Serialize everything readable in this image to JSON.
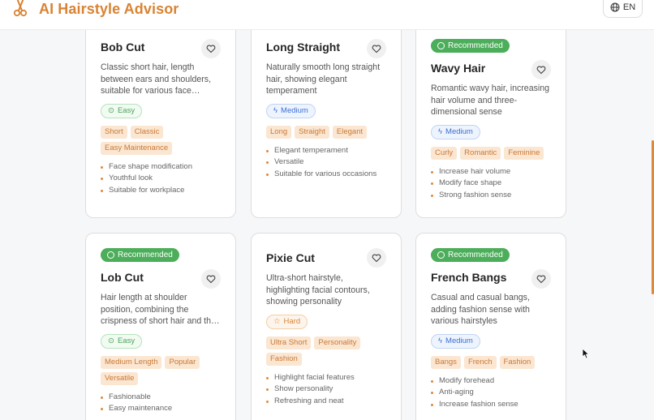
{
  "header": {
    "app_title": "AI Hairstyle Advisor",
    "lang_label": "EN"
  },
  "cards": [
    {
      "recommended": false,
      "title": "Bob Cut",
      "description": "Classic short hair, length between ears and shoulders, suitable for various face…",
      "difficulty": "Easy",
      "tags": [
        "Short",
        "Classic",
        "Easy Maintenance"
      ],
      "features": [
        "Face shape modification",
        "Youthful look",
        "Suitable for workplace"
      ]
    },
    {
      "recommended": false,
      "title": "Long Straight",
      "description": "Naturally smooth long straight hair, showing elegant temperament",
      "difficulty": "Medium",
      "tags": [
        "Long",
        "Straight",
        "Elegant"
      ],
      "features": [
        "Elegant temperament",
        "Versatile",
        "Suitable for various occasions"
      ]
    },
    {
      "recommended": true,
      "recommended_label": "Recommended",
      "title": "Wavy Hair",
      "description": "Romantic wavy hair, increasing hair volume and three-dimensional sense",
      "difficulty": "Medium",
      "tags": [
        "Curly",
        "Romantic",
        "Feminine"
      ],
      "features": [
        "Increase hair volume",
        "Modify face shape",
        "Strong fashion sense"
      ]
    },
    {
      "recommended": true,
      "recommended_label": "Recommended",
      "title": "Lob Cut",
      "description": "Hair length at shoulder position, combining the crispness of short hair and th…",
      "difficulty": "Easy",
      "tags": [
        "Medium Length",
        "Popular",
        "Versatile"
      ],
      "features": [
        "Fashionable",
        "Easy maintenance"
      ]
    },
    {
      "recommended": false,
      "title": "Pixie Cut",
      "description": "Ultra-short hairstyle, highlighting facial contours, showing personality",
      "difficulty": "Hard",
      "tags": [
        "Ultra Short",
        "Personality",
        "Fashion"
      ],
      "features": [
        "Highlight facial features",
        "Show personality",
        "Refreshing and neat"
      ]
    },
    {
      "recommended": true,
      "recommended_label": "Recommended",
      "title": "French Bangs",
      "description": "Casual and casual bangs, adding fashion sense with various hairstyles",
      "difficulty": "Medium",
      "tags": [
        "Bangs",
        "French",
        "Fashion"
      ],
      "features": [
        "Modify forehead",
        "Anti-aging",
        "Increase fashion sense"
      ]
    }
  ],
  "colors": {
    "accent": "#d98333",
    "recommended_badge": "#4cae5a",
    "tag_bg": "#fbe6d2"
  }
}
